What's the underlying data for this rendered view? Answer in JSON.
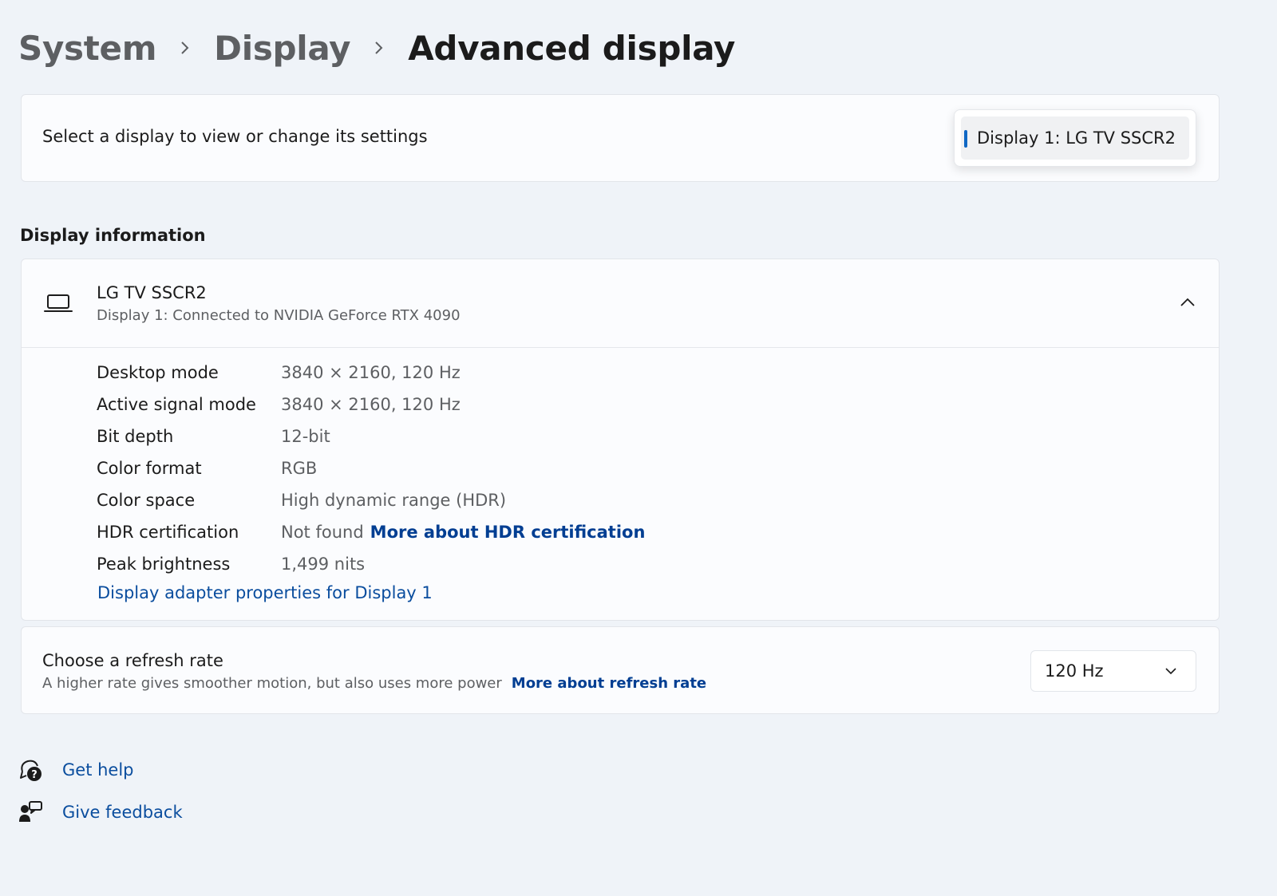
{
  "breadcrumb": {
    "items": [
      "System",
      "Display"
    ],
    "current": "Advanced display"
  },
  "select_display": {
    "label": "Select a display to view or change its settings",
    "selected": "Display 1: LG TV SSCR2"
  },
  "display_information": {
    "section_title": "Display information",
    "name": "LG TV SSCR2",
    "connection": "Display 1: Connected to NVIDIA GeForce RTX 4090",
    "properties": [
      {
        "name": "Desktop mode",
        "value": "3840 × 2160, 120 Hz"
      },
      {
        "name": "Active signal mode",
        "value": "3840 × 2160, 120 Hz"
      },
      {
        "name": "Bit depth",
        "value": "12-bit"
      },
      {
        "name": "Color format",
        "value": "RGB"
      },
      {
        "name": "Color space",
        "value": "High dynamic range (HDR)"
      },
      {
        "name": "HDR certification",
        "value": "Not found",
        "link": "More about HDR certification"
      },
      {
        "name": "Peak brightness",
        "value": "1,499 nits"
      }
    ],
    "adapter_link": "Display adapter properties for Display 1"
  },
  "refresh_rate": {
    "title": "Choose a refresh rate",
    "description": "A higher rate gives smoother motion, but also uses more power",
    "link": "More about refresh rate",
    "selected": "120 Hz"
  },
  "footer": {
    "get_help": "Get help",
    "give_feedback": "Give feedback"
  },
  "colors": {
    "accent": "#0f67c4",
    "link": "#003e92",
    "background": "#eff3f8",
    "card": "#fbfcfe"
  },
  "icons": [
    "chevron-right-icon",
    "laptop-icon",
    "chevron-up-icon",
    "chevron-down-icon",
    "help-icon",
    "feedback-icon"
  ]
}
